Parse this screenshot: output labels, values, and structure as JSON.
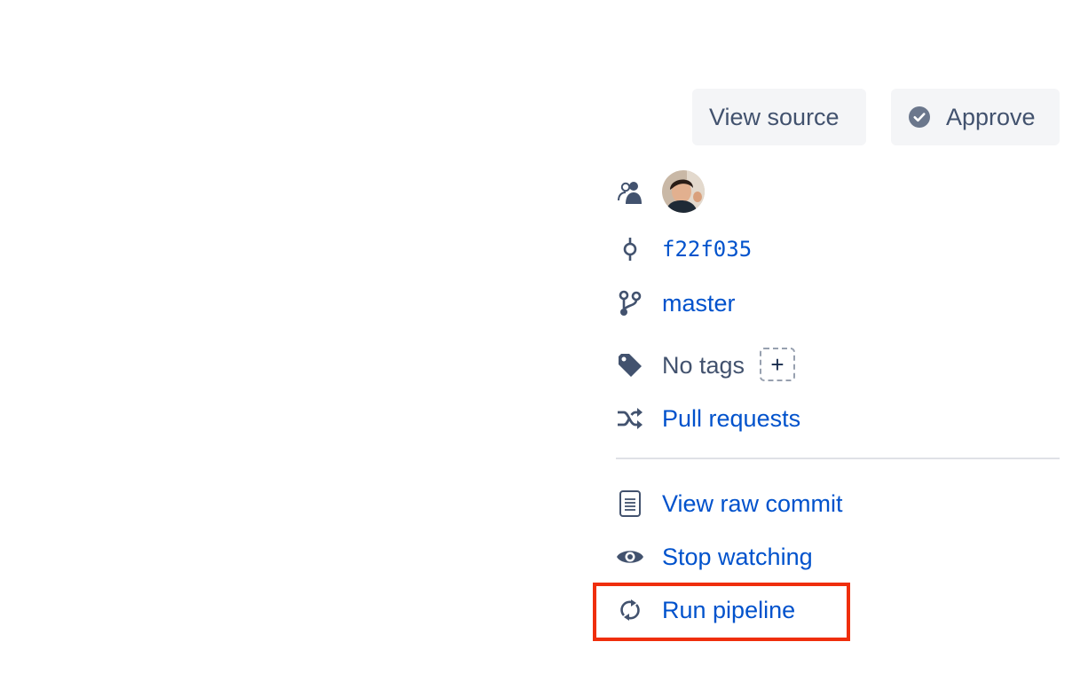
{
  "header_actions": {
    "view_source_label": "View source",
    "approve_label": "Approve"
  },
  "commit_info": {
    "author_avatar": "user-avatar-photo",
    "hash": "f22f035",
    "branch": "master",
    "tags_label": "No tags",
    "add_tag_symbol": "+",
    "pull_requests_label": "Pull requests"
  },
  "commit_actions": {
    "view_raw_label": "View raw commit",
    "watch_label": "Stop watching",
    "run_pipeline_label": "Run pipeline"
  },
  "colors": {
    "link": "#0052cc",
    "text": "#42526e",
    "button_bg": "#f4f5f7",
    "highlight": "#ef2e0c"
  }
}
